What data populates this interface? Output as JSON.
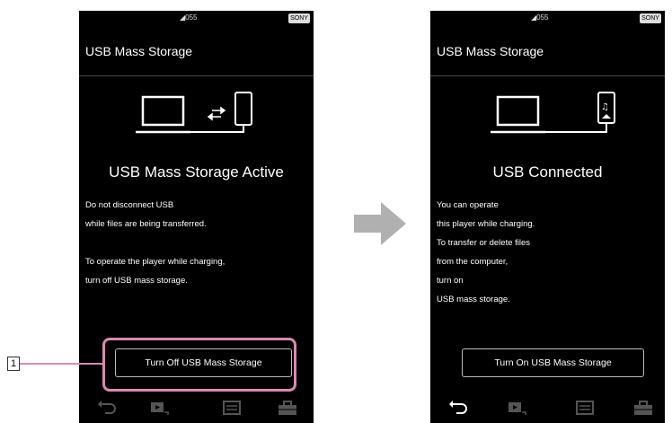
{
  "left_screen": {
    "status": {
      "signal": "◢055",
      "battery": "SONY"
    },
    "title": "USB Mass Storage",
    "heading": "USB Mass Storage Active",
    "description": "Do not disconnect USB\nwhile files are being transferred.\n\nTo operate the player while charging,\nturn off USB mass storage.",
    "button_label": "Turn Off USB Mass Storage"
  },
  "right_screen": {
    "status": {
      "signal": "◢055",
      "battery": "SONY"
    },
    "title": "USB Mass Storage",
    "heading": "USB Connected",
    "description": "You can operate\nthis player while charging.\nTo transfer or delete files\nfrom the computer,\nturn on\nUSB mass storage.",
    "button_label": "Turn On USB Mass Storage"
  },
  "callout": {
    "number": "1"
  },
  "navbar_icons": [
    "back-icon",
    "playback-icon",
    "library-icon",
    "toolbox-icon"
  ],
  "colors": {
    "highlight": "#d88bb2",
    "arrow": "#b0b0b0",
    "screen_bg": "#000000"
  }
}
